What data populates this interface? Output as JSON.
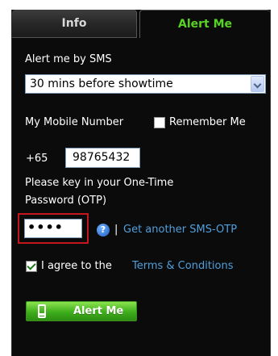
{
  "tabs": [
    {
      "label": "Info",
      "selected": false
    },
    {
      "label": "Alert Me",
      "selected": true
    }
  ],
  "sms": {
    "label": "Alert me by SMS",
    "selected_option": "30 mins before showtime"
  },
  "mobile": {
    "label": "My Mobile Number",
    "remember_label": "Remember Me",
    "remember_checked": false,
    "country_code": "+65",
    "number": "98765432"
  },
  "otp": {
    "prompt_line1": "Please key in your One-Time",
    "prompt_line2": "Password (OTP)",
    "masked_value": "••••",
    "help_glyph": "?",
    "separator": "|",
    "resend_link": "Get another SMS-OTP"
  },
  "agree": {
    "checked": true,
    "text": "I agree to the",
    "terms_link": "Terms & Conditions"
  },
  "submit": {
    "label": "Alert Me",
    "icon": "mobile-phone-icon"
  },
  "colors": {
    "panel_bg": "#0b0b0b",
    "accent_green": "#58d321",
    "link_blue": "#4f9fdc",
    "error_red": "#c4161c",
    "button_green": "#3eae1c"
  }
}
